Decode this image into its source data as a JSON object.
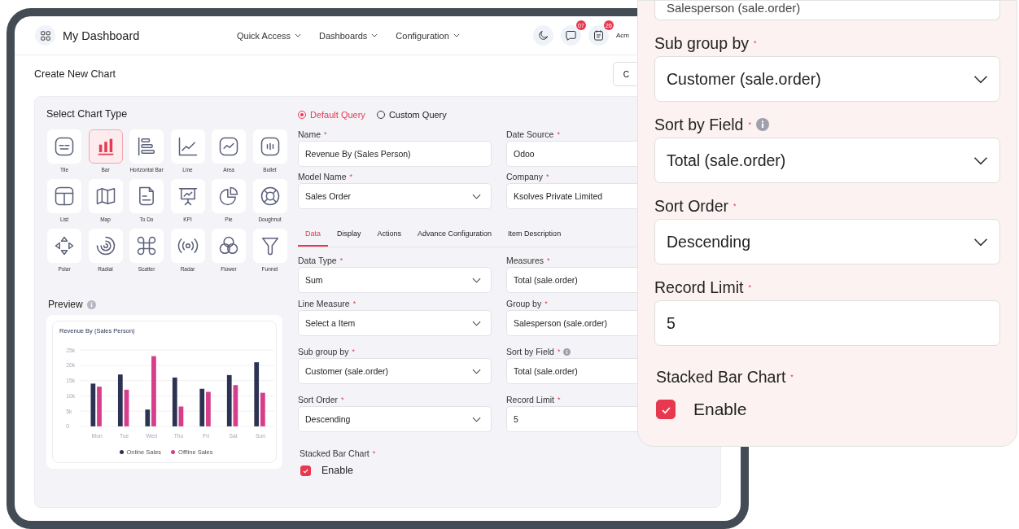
{
  "header": {
    "title": "My Dashboard",
    "nav": [
      {
        "label": "Quick Access"
      },
      {
        "label": "Dashboards"
      },
      {
        "label": "Configuration"
      }
    ],
    "actions": [
      {
        "kind": "moon"
      },
      {
        "kind": "chat",
        "badge": "07"
      },
      {
        "kind": "calendar",
        "badge": "26"
      }
    ],
    "user": "Acm"
  },
  "page": {
    "title": "Create New Chart",
    "button": "C"
  },
  "chart_types": {
    "title": "Select Chart Type",
    "items": [
      {
        "label": "Tile",
        "selected": false
      },
      {
        "label": "Bar",
        "selected": true
      },
      {
        "label": "Horizontal Bar",
        "selected": false
      },
      {
        "label": "Line",
        "selected": false
      },
      {
        "label": "Area",
        "selected": false
      },
      {
        "label": "Bullet",
        "selected": false
      },
      {
        "label": "List",
        "selected": false
      },
      {
        "label": "Map",
        "selected": false
      },
      {
        "label": "To Do",
        "selected": false
      },
      {
        "label": "KPI",
        "selected": false
      },
      {
        "label": "Pie",
        "selected": false
      },
      {
        "label": "Doughnut",
        "selected": false
      },
      {
        "label": "Polar",
        "selected": false
      },
      {
        "label": "Radial",
        "selected": false
      },
      {
        "label": "Scatter",
        "selected": false
      },
      {
        "label": "Radar",
        "selected": false
      },
      {
        "label": "Flower",
        "selected": false
      },
      {
        "label": "Funnel",
        "selected": false
      }
    ]
  },
  "preview": {
    "title": "Preview",
    "chart_data": {
      "type": "bar",
      "title": "Revenue By (Sales Person)",
      "categories": [
        "Mon",
        "Tue",
        "Wed",
        "Thu",
        "Fri",
        "Sat",
        "Sun"
      ],
      "series": [
        {
          "name": "Online Sales",
          "color": "#2b3252",
          "values": [
            14000,
            17000,
            5500,
            16000,
            12300,
            16800,
            21000
          ]
        },
        {
          "name": "Offline Sales",
          "color": "#d63d8a",
          "values": [
            13000,
            12000,
            23000,
            6500,
            11300,
            13500,
            11000
          ]
        }
      ],
      "ylim": [
        0,
        25000
      ],
      "yticks": [
        {
          "value": 0,
          "label": "0"
        },
        {
          "value": 5000,
          "label": "5k"
        },
        {
          "value": 10000,
          "label": "10k"
        },
        {
          "value": 15000,
          "label": "15k"
        },
        {
          "value": 20000,
          "label": "20k"
        },
        {
          "value": 25000,
          "label": "25k"
        }
      ],
      "grid": true,
      "legend": "bottom"
    }
  },
  "query": {
    "options": [
      {
        "label": "Default Query",
        "selected": true
      },
      {
        "label": "Custom Query",
        "selected": false
      }
    ]
  },
  "fields_top": [
    {
      "label": "Name",
      "mark": "*",
      "value": "Revenue By (Sales Person)",
      "kind": "input"
    },
    {
      "label": "Date Source",
      "mark": "*",
      "value": "Odoo",
      "kind": "input"
    },
    {
      "label": "Model Name",
      "mark": "*",
      "value": "Sales Order",
      "kind": "select"
    },
    {
      "label": "Company",
      "mark": "*",
      "value": "Ksolves Private Limited",
      "kind": "input"
    }
  ],
  "tabs": [
    {
      "label": "Data",
      "selected": true
    },
    {
      "label": "Display",
      "selected": false
    },
    {
      "label": "Actions",
      "selected": false
    },
    {
      "label": "Advance Configuration",
      "selected": false
    },
    {
      "label": "Item Description",
      "selected": false
    }
  ],
  "fields": [
    {
      "label": "Data Type",
      "mark": "*",
      "value": "Sum",
      "kind": "select"
    },
    {
      "label": "Measures",
      "mark": "*",
      "value": "Total (sale.order)",
      "kind": "input"
    },
    {
      "label": "Line Measure",
      "mark": "*",
      "value": "Select a Item",
      "kind": "select"
    },
    {
      "label": "Group by",
      "mark": "*",
      "value": "Salesperson (sale.order)",
      "kind": "input"
    },
    {
      "label": "Sub group by",
      "mark": "*",
      "value": "Customer (sale.order)",
      "kind": "select"
    },
    {
      "label": "Sort by Field",
      "mark": "*",
      "value": "Total  (sale.order)",
      "kind": "input",
      "info": true
    },
    {
      "label": "Sort Order",
      "mark": "*",
      "value": "Descending",
      "kind": "select"
    },
    {
      "label": "Record Limit",
      "mark": "*",
      "value": "5",
      "kind": "input"
    }
  ],
  "stacked": {
    "label": "Stacked Bar Chart",
    "mark": "*",
    "option": "Enable",
    "checked": true
  },
  "zoom_panel": {
    "partial_value": "Salesperson (sale.order)",
    "fields": [
      {
        "label": "Sub group by",
        "mark": "*",
        "value": "Customer (sale.order)",
        "kind": "select"
      },
      {
        "label": "Sort by Field",
        "mark": "*",
        "value": "Total  (sale.order)",
        "kind": "select",
        "info": true
      },
      {
        "label": "Sort Order",
        "mark": "*",
        "value": "Descending",
        "kind": "select"
      },
      {
        "label": "Record Limit",
        "mark": "*",
        "value": "5",
        "kind": "input"
      }
    ],
    "stacked": {
      "label": "Stacked Bar Chart",
      "mark": "*",
      "option": "Enable",
      "checked": true
    }
  }
}
